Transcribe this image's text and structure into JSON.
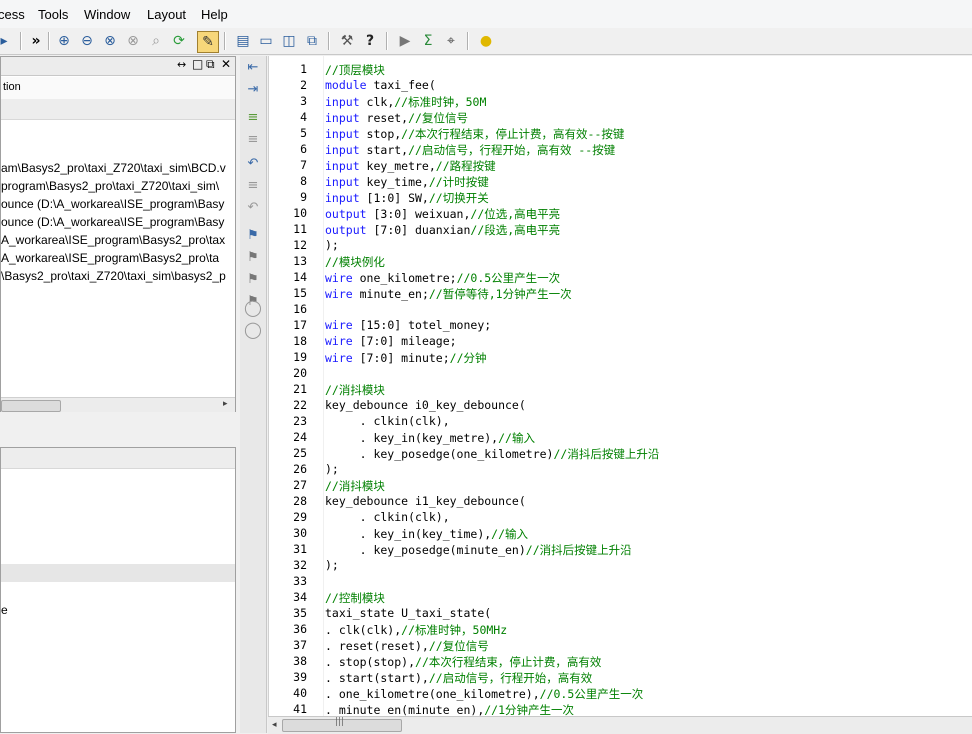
{
  "menu": [
    "cess",
    "Tools",
    "Window",
    "Layout",
    "Help"
  ],
  "panel": {
    "controls": [
      "↔",
      "□",
      "⧉",
      "✕"
    ],
    "column_header": "tion",
    "files": [
      "am\\Basys2_pro\\taxi_Z720\\taxi_sim\\BCD.v",
      "program\\Basys2_pro\\taxi_Z720\\taxi_sim\\",
      "ounce (D:\\A_workarea\\ISE_program\\Basy",
      "ounce (D:\\A_workarea\\ISE_program\\Basy",
      "A_workarea\\ISE_program\\Basys2_pro\\tax",
      "A_workarea\\ISE_program\\Basys2_pro\\ta",
      "\\Basys2_pro\\taxi_Z720\\taxi_sim\\basys2_p"
    ],
    "bottom_item": "e"
  },
  "editor": {
    "lines": [
      {
        "n": "1",
        "segs": [
          {
            "t": "//顶层模块",
            "c": "cm"
          }
        ]
      },
      {
        "n": "2",
        "segs": [
          {
            "t": "module",
            "c": "kw"
          },
          {
            "t": " taxi_fee(",
            "c": ""
          }
        ]
      },
      {
        "n": "3",
        "segs": [
          {
            "t": "input",
            "c": "kw"
          },
          {
            "t": " clk,",
            "c": ""
          },
          {
            "t": "//标准时钟，50M",
            "c": "cm"
          }
        ]
      },
      {
        "n": "4",
        "segs": [
          {
            "t": "input",
            "c": "kw"
          },
          {
            "t": " reset,",
            "c": ""
          },
          {
            "t": "//复位信号",
            "c": "cm"
          }
        ]
      },
      {
        "n": "5",
        "segs": [
          {
            "t": "input",
            "c": "kw"
          },
          {
            "t": " stop,",
            "c": ""
          },
          {
            "t": "//本次行程结束，停止计费，高有效--按键",
            "c": "cm"
          }
        ]
      },
      {
        "n": "6",
        "segs": [
          {
            "t": "input",
            "c": "kw"
          },
          {
            "t": " start,",
            "c": ""
          },
          {
            "t": "//启动信号，行程开始，高有效 --按键",
            "c": "cm"
          }
        ]
      },
      {
        "n": "7",
        "segs": [
          {
            "t": "input",
            "c": "kw"
          },
          {
            "t": " key_metre,",
            "c": ""
          },
          {
            "t": "//路程按键",
            "c": "cm"
          }
        ]
      },
      {
        "n": "8",
        "segs": [
          {
            "t": "input",
            "c": "kw"
          },
          {
            "t": " key_time,",
            "c": ""
          },
          {
            "t": "//计时按键",
            "c": "cm"
          }
        ]
      },
      {
        "n": "9",
        "segs": [
          {
            "t": "input",
            "c": "kw"
          },
          {
            "t": " [1:0] SW,",
            "c": ""
          },
          {
            "t": "//切换开关",
            "c": "cm"
          }
        ]
      },
      {
        "n": "10",
        "segs": [
          {
            "t": "output",
            "c": "kw"
          },
          {
            "t": " [3:0] weixuan,",
            "c": ""
          },
          {
            "t": "//位选,高电平亮",
            "c": "cm"
          }
        ]
      },
      {
        "n": "11",
        "segs": [
          {
            "t": "output",
            "c": "kw"
          },
          {
            "t": " [7:0] duanxian",
            "c": ""
          },
          {
            "t": "//段选,高电平亮",
            "c": "cm"
          }
        ]
      },
      {
        "n": "12",
        "segs": [
          {
            "t": ");",
            "c": ""
          }
        ]
      },
      {
        "n": "13",
        "segs": [
          {
            "t": "//模块例化",
            "c": "cm"
          }
        ]
      },
      {
        "n": "14",
        "segs": [
          {
            "t": "wire",
            "c": "kw"
          },
          {
            "t": " one_kilometre;",
            "c": ""
          },
          {
            "t": "//0.5公里产生一次",
            "c": "cm"
          }
        ]
      },
      {
        "n": "15",
        "segs": [
          {
            "t": "wire",
            "c": "kw"
          },
          {
            "t": " minute_en;",
            "c": ""
          },
          {
            "t": "//暂停等待,1分钟产生一次",
            "c": "cm"
          }
        ]
      },
      {
        "n": "16",
        "segs": []
      },
      {
        "n": "17",
        "segs": [
          {
            "t": "wire",
            "c": "kw"
          },
          {
            "t": " [15:0] totel_money;",
            "c": ""
          }
        ]
      },
      {
        "n": "18",
        "segs": [
          {
            "t": "wire",
            "c": "kw"
          },
          {
            "t": " [7:0] mileage;",
            "c": ""
          }
        ]
      },
      {
        "n": "19",
        "segs": [
          {
            "t": "wire",
            "c": "kw"
          },
          {
            "t": " [7:0] minute;",
            "c": ""
          },
          {
            "t": "//分钟",
            "c": "cm"
          }
        ]
      },
      {
        "n": "20",
        "segs": []
      },
      {
        "n": "21",
        "segs": [
          {
            "t": "//消抖模块",
            "c": "cm"
          }
        ]
      },
      {
        "n": "22",
        "segs": [
          {
            "t": "key_debounce i0_key_debounce(",
            "c": ""
          }
        ]
      },
      {
        "n": "23",
        "segs": [
          {
            "t": "     . clkin(clk),",
            "c": ""
          }
        ]
      },
      {
        "n": "24",
        "segs": [
          {
            "t": "     . key_in(key_metre),",
            "c": ""
          },
          {
            "t": "//输入",
            "c": "cm"
          }
        ]
      },
      {
        "n": "25",
        "segs": [
          {
            "t": "     . key_posedge(one_kilometre)",
            "c": ""
          },
          {
            "t": "//消抖后按键上升沿",
            "c": "cm"
          }
        ]
      },
      {
        "n": "26",
        "segs": [
          {
            "t": ");",
            "c": ""
          }
        ]
      },
      {
        "n": "27",
        "segs": [
          {
            "t": "//消抖模块",
            "c": "cm"
          }
        ]
      },
      {
        "n": "28",
        "segs": [
          {
            "t": "key_debounce i1_key_debounce(",
            "c": ""
          }
        ]
      },
      {
        "n": "29",
        "segs": [
          {
            "t": "     . clkin(clk),",
            "c": ""
          }
        ]
      },
      {
        "n": "30",
        "segs": [
          {
            "t": "     . key_in(key_time),",
            "c": ""
          },
          {
            "t": "//输入",
            "c": "cm"
          }
        ]
      },
      {
        "n": "31",
        "segs": [
          {
            "t": "     . key_posedge(minute_en)",
            "c": ""
          },
          {
            "t": "//消抖后按键上升沿",
            "c": "cm"
          }
        ]
      },
      {
        "n": "32",
        "segs": [
          {
            "t": ");",
            "c": ""
          }
        ]
      },
      {
        "n": "33",
        "segs": []
      },
      {
        "n": "34",
        "segs": [
          {
            "t": "//控制模块",
            "c": "cm"
          }
        ]
      },
      {
        "n": "35",
        "segs": [
          {
            "t": "taxi_state U_taxi_state(",
            "c": ""
          }
        ]
      },
      {
        "n": "36",
        "segs": [
          {
            "t": ". clk(clk),",
            "c": ""
          },
          {
            "t": "//标准时钟，50MHz",
            "c": "cm"
          }
        ]
      },
      {
        "n": "37",
        "segs": [
          {
            "t": ". reset(reset),",
            "c": ""
          },
          {
            "t": "//复位信号",
            "c": "cm"
          }
        ]
      },
      {
        "n": "38",
        "segs": [
          {
            "t": ". stop(stop),",
            "c": ""
          },
          {
            "t": "//本次行程结束，停止计费，高有效",
            "c": "cm"
          }
        ]
      },
      {
        "n": "39",
        "segs": [
          {
            "t": ". start(start),",
            "c": ""
          },
          {
            "t": "//启动信号，行程开始，高有效",
            "c": "cm"
          }
        ]
      },
      {
        "n": "40",
        "segs": [
          {
            "t": ". one_kilometre(one_kilometre),",
            "c": ""
          },
          {
            "t": "//0.5公里产生一次",
            "c": "cm"
          }
        ]
      },
      {
        "n": "41",
        "segs": [
          {
            "t": ". minute_en(minute_en),",
            "c": ""
          },
          {
            "t": "//1分钟产生一次",
            "c": "cm"
          }
        ]
      }
    ]
  }
}
